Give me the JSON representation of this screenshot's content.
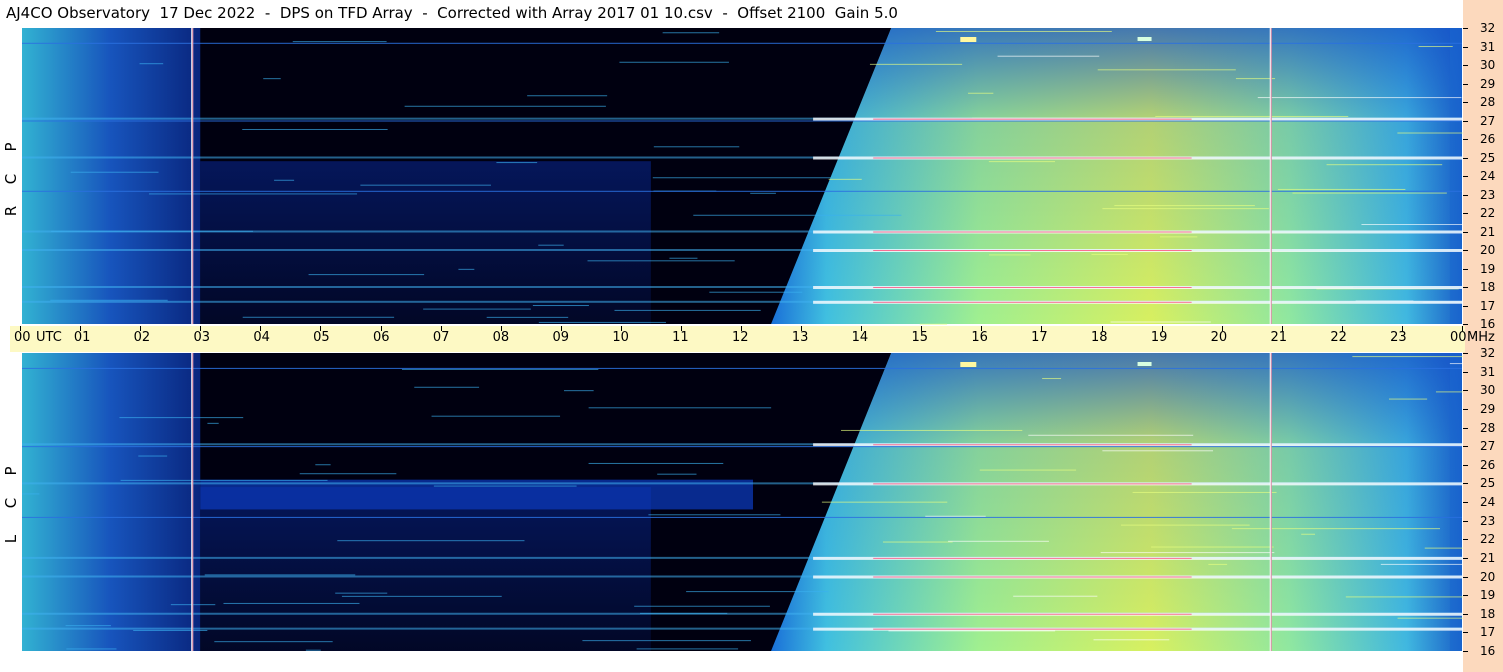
{
  "title": "AJ4CO Observatory  17 Dec 2022  -  DPS on TFD Array  -  Corrected with Array 2017 01 10.csv  -  Offset 2100  Gain 5.0",
  "colors": {
    "background": "#000010",
    "deep_blue": "#0a2a8a",
    "mid_blue": "#1560d8",
    "cyan": "#30b8e8",
    "teal_green": "#6ee0b0",
    "yellow_green": "#d8f060",
    "right_axis_bg": "#fcd9bd",
    "time_axis_bg": "#fdf9c4"
  },
  "chart_data": {
    "type": "heatmap",
    "title": "AJ4CO Observatory  17 Dec 2022  -  DPS on TFD Array  -  Corrected with Array 2017 01 10.csv  -  Offset 2100  Gain 5.0",
    "x_axis": {
      "unit_label": "UTC",
      "range_hours": [
        0,
        24
      ],
      "tick_labels": [
        "00",
        "01",
        "02",
        "03",
        "04",
        "05",
        "06",
        "07",
        "08",
        "09",
        "10",
        "11",
        "12",
        "13",
        "14",
        "15",
        "16",
        "17",
        "18",
        "19",
        "20",
        "21",
        "22",
        "23",
        "00"
      ]
    },
    "y_axis": {
      "unit_label": "MHz",
      "range": [
        16,
        32
      ],
      "tick_labels": [
        "32",
        "31",
        "30",
        "29",
        "28",
        "27",
        "26",
        "25",
        "24",
        "23",
        "22",
        "21",
        "20",
        "19",
        "18",
        "17",
        "16"
      ]
    },
    "panels": [
      {
        "polarization_letters": [
          "R",
          "C",
          "P"
        ]
      },
      {
        "polarization_letters": [
          "L",
          "C",
          "P"
        ]
      }
    ],
    "features": {
      "sunrise_edge_utc_at_16mhz": 12.5,
      "sunrise_edge_utc_at_32mhz": 14.5,
      "night_dark_start_utc": 3.0,
      "day_fade_utc": 23.8,
      "vertical_lines_utc": [
        2.85,
        20.8
      ],
      "bright_bands_mhz": [
        27.1,
        25.0,
        21.0,
        20.0,
        18.0,
        17.2
      ],
      "thin_lines_mhz": [
        31.2,
        27.0,
        23.2
      ]
    },
    "grid": false,
    "legend": "none"
  }
}
